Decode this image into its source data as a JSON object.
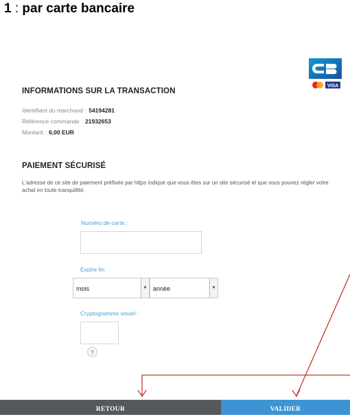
{
  "heading": {
    "number": "1",
    "separator": ":",
    "text": "par carte bancaire"
  },
  "logo": {
    "cb": "CB",
    "visa": "VISA",
    "icons": [
      "cb-logo-icon",
      "mastercard-icon",
      "visa-icon"
    ]
  },
  "transaction": {
    "title": "INFORMATIONS SUR LA TRANSACTION",
    "merchant_label": "Identifiant du marchand",
    "merchant_value": "54194281",
    "reference_label": "Référence commande",
    "reference_value": "21932653",
    "amount_label": "Montant",
    "amount_value": "6,00 EUR"
  },
  "payment": {
    "title": "PAIEMENT SÉCURISÉ",
    "description": "L'adresse de ce site de paiement préfixée par https indique que vous êtes sur un site sécurisé et que vous pouvez régler votre achat en toute tranquillité."
  },
  "form": {
    "card_number_label": "Numéro de carte :",
    "card_number_value": "",
    "expiry_label": "Expire fin",
    "month_value": "mois",
    "year_value": "année",
    "cvv_label": "Cryptogramme visuel :",
    "cvv_value": "",
    "help_symbol": "?"
  },
  "buttons": {
    "back": "RETOUR",
    "submit": "VALIDER"
  },
  "colors": {
    "accent": "#3d93d3",
    "back_button": "#55595c",
    "label_blue": "#4a9fd5",
    "annotation_red": "#c0392b"
  }
}
